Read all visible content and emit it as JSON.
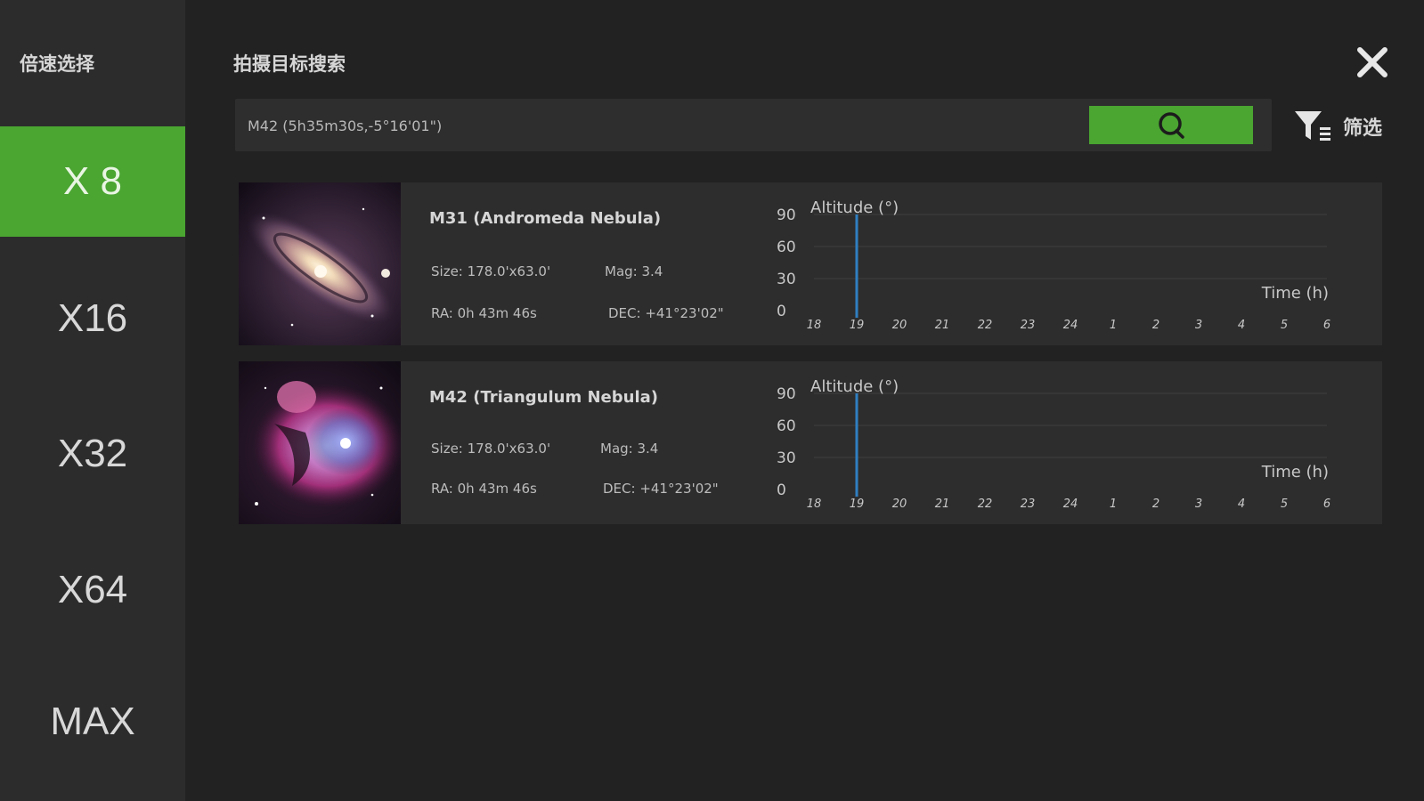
{
  "sidebar": {
    "title": "倍速选择",
    "items": [
      {
        "label": "X 8",
        "active": true
      },
      {
        "label": "X16",
        "active": false
      },
      {
        "label": "X32",
        "active": false
      },
      {
        "label": "X64",
        "active": false
      },
      {
        "label": "MAX",
        "active": false
      }
    ]
  },
  "header": {
    "title": "拍摄目标搜索",
    "close_icon": "close-icon"
  },
  "search": {
    "value": "M42 (5h35m30s,-5°16'01\")",
    "button_icon": "search-icon"
  },
  "filter": {
    "label": "筛选",
    "icon": "filter-icon"
  },
  "results": [
    {
      "name": "M31 (Andromeda Nebula)",
      "size": "Size: 178.0'x63.0'",
      "mag": "Mag: 3.4",
      "ra": "RA: 0h 43m 46s",
      "dec": "DEC: +41°23'02\"",
      "thumbnail": "galaxy-image"
    },
    {
      "name": "M42 (Triangulum Nebula)",
      "size": "Size: 178.0'x63.0'",
      "mag": "Mag: 3.4",
      "ra": "RA: 0h 43m 46s",
      "dec": "DEC: +41°23'02\"",
      "thumbnail": "nebula-image"
    }
  ],
  "chart_data": [
    {
      "type": "line",
      "ylabel": "Altitude (°)",
      "xlabel": "Time (h)",
      "y_ticks": [
        "90",
        "60",
        "30",
        "0"
      ],
      "ylim": [
        0,
        90
      ],
      "x_ticks": [
        "18",
        "19",
        "20",
        "21",
        "22",
        "23",
        "24",
        "1",
        "2",
        "3",
        "4",
        "5",
        "6"
      ],
      "marker_time": "19",
      "grid": true,
      "line_color": "#2f7fc1"
    },
    {
      "type": "line",
      "ylabel": "Altitude (°)",
      "xlabel": "Time (h)",
      "y_ticks": [
        "90",
        "60",
        "30",
        "0"
      ],
      "ylim": [
        0,
        90
      ],
      "x_ticks": [
        "18",
        "19",
        "20",
        "21",
        "22",
        "23",
        "24",
        "1",
        "2",
        "3",
        "4",
        "5",
        "6"
      ],
      "marker_time": "19",
      "grid": true,
      "line_color": "#2f7fc1"
    }
  ],
  "colors": {
    "accent": "#4aa531",
    "background": "#222222",
    "sidebar": "#2c2c2c",
    "card": "#2d2d2d"
  }
}
